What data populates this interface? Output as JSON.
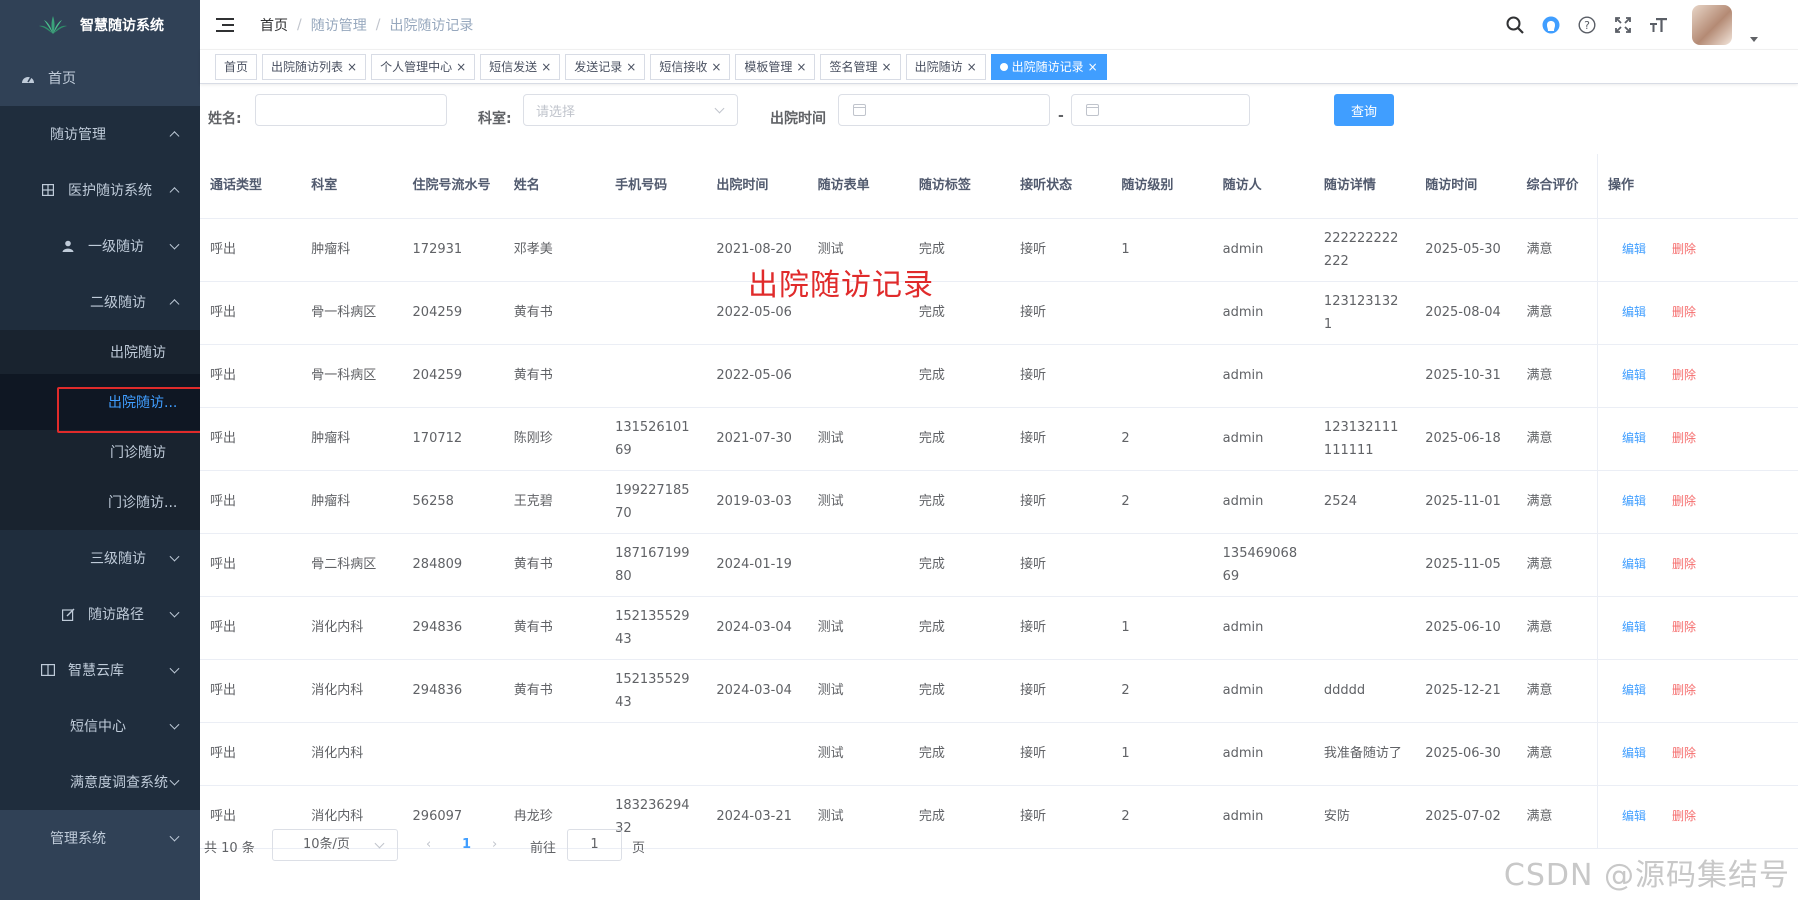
{
  "app": {
    "title": "智慧随访系统"
  },
  "sidebar": {
    "home": "首页",
    "followup_mgmt": "随访管理",
    "medical_system": "医护随访系统",
    "level1": "一级随访",
    "level2": "二级随访",
    "discharge_followup": "出院随访",
    "discharge_records": "出院随访...",
    "outpatient_followup": "门诊随访",
    "outpatient_records": "门诊随访...",
    "level3": "三级随访",
    "followup_path": "随访路径",
    "smart_cloud": "智慧云库",
    "sms_center": "短信中心",
    "satisfaction": "满意度调查系统",
    "admin_system": "管理系统"
  },
  "breadcrumb": {
    "home": "首页",
    "sep": "/",
    "level1": "随访管理",
    "level2": "出院随访记录"
  },
  "tags": [
    {
      "label": "首页",
      "closable": false,
      "active": false
    },
    {
      "label": "出院随访列表",
      "closable": true,
      "active": false
    },
    {
      "label": "个人管理中心",
      "closable": true,
      "active": false
    },
    {
      "label": "短信发送",
      "closable": true,
      "active": false
    },
    {
      "label": "发送记录",
      "closable": true,
      "active": false
    },
    {
      "label": "短信接收",
      "closable": true,
      "active": false
    },
    {
      "label": "模板管理",
      "closable": true,
      "active": false
    },
    {
      "label": "签名管理",
      "closable": true,
      "active": false
    },
    {
      "label": "出院随访",
      "closable": true,
      "active": false
    },
    {
      "label": "出院随访记录",
      "closable": true,
      "active": true
    }
  ],
  "tag_close": "×",
  "filter": {
    "name_label": "姓名:",
    "dept_label": "科室:",
    "dept_placeholder": "请选择",
    "discharge_label": "出院时间",
    "range_sep": "-",
    "query_button": "查询"
  },
  "overlay_title": "出院随访记录",
  "table": {
    "headers": [
      "通话类型",
      "科室",
      "住院号流水号",
      "姓名",
      "手机号码",
      "出院时间",
      "随访表单",
      "随访标签",
      "接听状态",
      "随访级别",
      "随访人",
      "随访详情",
      "随访时间",
      "综合评价",
      "操作"
    ],
    "rows": [
      [
        "呼出",
        "肿瘤科",
        "172931",
        "邓孝美",
        "",
        "2021-08-20",
        "测试",
        "完成",
        "接听",
        "1",
        "admin",
        "222222222222",
        "2025-05-30",
        "满意"
      ],
      [
        "呼出",
        "骨一科病区",
        "204259",
        "黄有书",
        "",
        "2022-05-06",
        "",
        "完成",
        "接听",
        "",
        "admin",
        "1231231321",
        "2025-08-04",
        "满意"
      ],
      [
        "呼出",
        "骨一科病区",
        "204259",
        "黄有书",
        "",
        "2022-05-06",
        "",
        "完成",
        "接听",
        "",
        "admin",
        "",
        "2025-10-31",
        "满意"
      ],
      [
        "呼出",
        "肿瘤科",
        "170712",
        "陈刚珍",
        "13152610169",
        "2021-07-30",
        "测试",
        "完成",
        "接听",
        "2",
        "admin",
        "123132111111111",
        "2025-06-18",
        "满意"
      ],
      [
        "呼出",
        "肿瘤科",
        "56258",
        "王克碧",
        "19922718570",
        "2019-03-03",
        "测试",
        "完成",
        "接听",
        "2",
        "admin",
        "2524",
        "2025-11-01",
        "满意"
      ],
      [
        "呼出",
        "骨二科病区",
        "284809",
        "黄有书",
        "18716719980",
        "2024-01-19",
        "",
        "完成",
        "接听",
        "",
        "13546906869",
        "",
        "2025-11-05",
        "满意"
      ],
      [
        "呼出",
        "消化内科",
        "294836",
        "黄有书",
        "15213552943",
        "2024-03-04",
        "测试",
        "完成",
        "接听",
        "1",
        "admin",
        "",
        "2025-06-10",
        "满意"
      ],
      [
        "呼出",
        "消化内科",
        "294836",
        "黄有书",
        "15213552943",
        "2024-03-04",
        "测试",
        "完成",
        "接听",
        "2",
        "admin",
        "ddddd",
        "2025-12-21",
        "满意"
      ],
      [
        "呼出",
        "消化内科",
        "",
        "",
        "",
        "",
        "测试",
        "完成",
        "接听",
        "1",
        "admin",
        "我准备随访了",
        "2025-06-30",
        "满意"
      ],
      [
        "呼出",
        "消化内科",
        "296097",
        "冉龙珍",
        "18323629432",
        "2024-03-21",
        "测试",
        "完成",
        "接听",
        "2",
        "admin",
        "安防",
        "2025-07-02",
        "满意"
      ]
    ],
    "edit_label": "编辑",
    "delete_label": "删除"
  },
  "pagination": {
    "total": "共 10 条",
    "page_size": "10条/页",
    "prev": "‹",
    "current": "1",
    "next": "›",
    "goto": "前往",
    "goto_value": "1",
    "page_unit": "页"
  },
  "watermark": "CSDN @源码集结号",
  "colors": {
    "sidebar_bg": "#304156",
    "accent": "#409eff",
    "danger": "#f56c6c",
    "highlight": "#e02b2b"
  }
}
